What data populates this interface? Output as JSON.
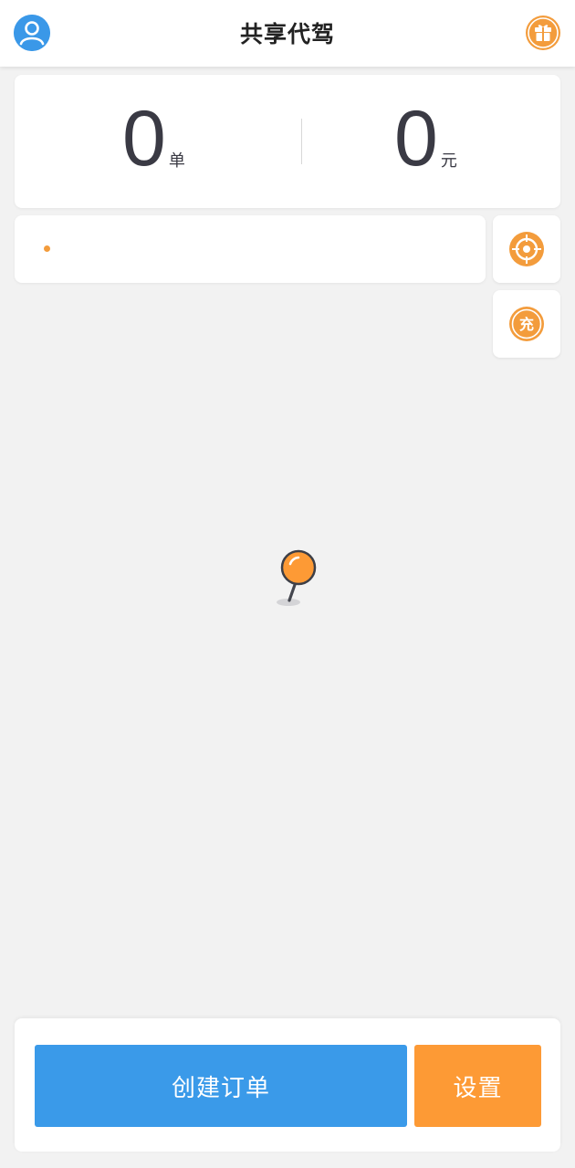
{
  "header": {
    "title": "共享代驾",
    "avatar_icon": "user-avatar-icon",
    "gift_icon": "gift-icon"
  },
  "stats": {
    "orders_value": "0",
    "orders_unit": "单",
    "income_value": "0",
    "income_unit": "元"
  },
  "address": {
    "text": ""
  },
  "side_buttons": {
    "locate_icon": "locate-target-icon",
    "charge_icon": "recharge-icon",
    "charge_label": "充"
  },
  "map": {
    "pin_icon": "map-pin-icon"
  },
  "actions": {
    "create_order_label": "创建订单",
    "settings_label": "设置"
  },
  "colors": {
    "primary_blue": "#3a9ae9",
    "accent_orange": "#fd9a35",
    "background": "#f2f2f2"
  }
}
